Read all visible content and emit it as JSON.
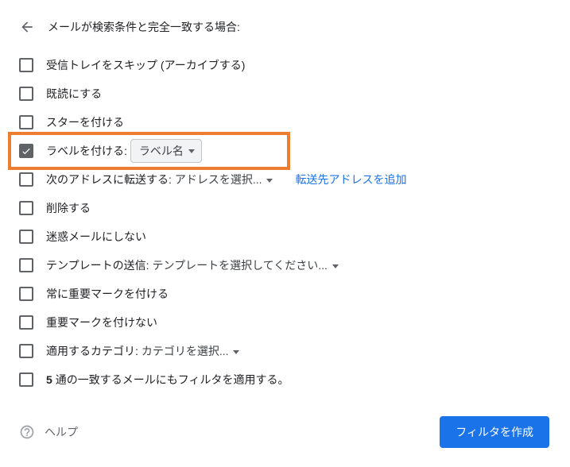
{
  "header": {
    "title": "メールが検索条件と完全一致する場合:"
  },
  "rows": {
    "skip_inbox": {
      "label": "受信トレイをスキップ (アーカイブする)",
      "checked": false
    },
    "mark_read": {
      "label": "既読にする",
      "checked": false
    },
    "star": {
      "label": "スターを付ける",
      "checked": false
    },
    "apply_label": {
      "label": "ラベルを付ける:",
      "checked": true,
      "select": "ラベル名"
    },
    "forward": {
      "label": "次のアドレスに転送する:",
      "checked": false,
      "select": "アドレスを選択...",
      "link": "転送先アドレスを追加"
    },
    "delete": {
      "label": "削除する",
      "checked": false
    },
    "never_spam": {
      "label": "迷惑メールにしない",
      "checked": false
    },
    "send_template": {
      "label": "テンプレートの送信:",
      "checked": false,
      "select_plain": "テンプレートを選択してください..."
    },
    "always_important": {
      "label": "常に重要マークを付ける",
      "checked": false
    },
    "never_important": {
      "label": "重要マークを付けない",
      "checked": false
    },
    "categorize": {
      "label": "適用するカテゴリ:",
      "checked": false,
      "select_plain": "カテゴリを選択..."
    },
    "also_apply": {
      "count": "5",
      "label_rest": " 通の一致するメールにもフィルタを適用する。",
      "checked": false
    }
  },
  "footer": {
    "help": "ヘルプ",
    "create": "フィルタを作成"
  }
}
